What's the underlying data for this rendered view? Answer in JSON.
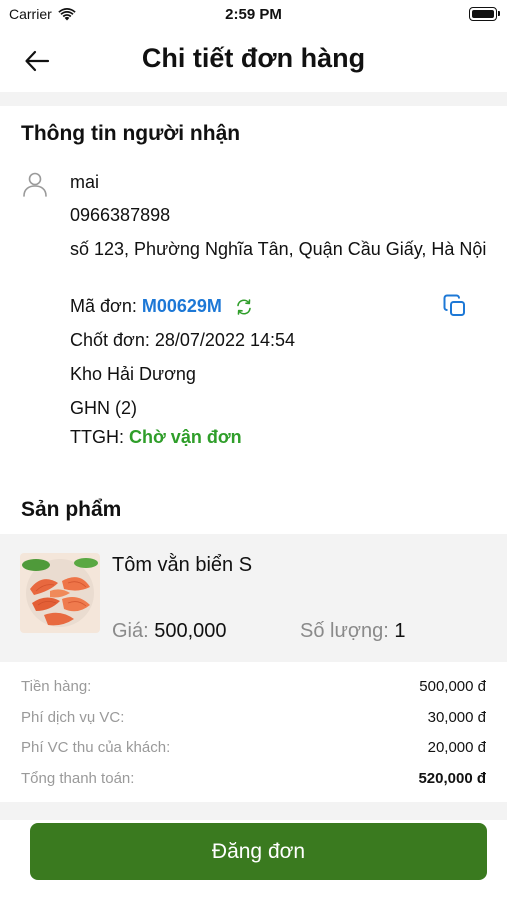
{
  "status_bar": {
    "carrier": "Carrier",
    "time": "2:59 PM"
  },
  "header": {
    "title": "Chi tiết đơn hàng"
  },
  "recipient": {
    "section_title": "Thông tin người nhận",
    "name": "mai",
    "phone": "0966387898",
    "address": "số 123, Phường Nghĩa Tân, Quận Cầu Giấy, Hà Nội",
    "order_code_label": "Mã đơn:",
    "order_code": "M00629M",
    "closed_label": "Chốt đơn:",
    "closed_at": "28/07/2022 14:54",
    "warehouse": "Kho Hải Dương",
    "carrier_service": "GHN (2)",
    "status_label": "TTGH:",
    "status_value": "Chờ vận đơn"
  },
  "products": {
    "section_title": "Sản phẩm",
    "items": [
      {
        "name": "Tôm vằn biển S",
        "price_label": "Giá:",
        "price": "500,000",
        "qty_label": "Số lượng:",
        "qty": "1"
      }
    ]
  },
  "summary": {
    "rows": [
      {
        "label": "Tiền hàng:",
        "value": "500,000 đ"
      },
      {
        "label": "Phí dịch vụ VC:",
        "value": "30,000 đ"
      },
      {
        "label": "Phí VC thu của khách:",
        "value": "20,000 đ"
      },
      {
        "label": "Tổng thanh toán:",
        "value": "520,000 đ"
      }
    ]
  },
  "actions": {
    "submit_label": "Đăng đơn"
  },
  "colors": {
    "accent_blue": "#1d78d6",
    "status_green": "#2f9e2a",
    "button_green": "#3a7a1f"
  },
  "icons": [
    "wifi-icon",
    "battery-icon",
    "back-arrow-icon",
    "person-icon",
    "sync-icon",
    "copy-icon"
  ]
}
